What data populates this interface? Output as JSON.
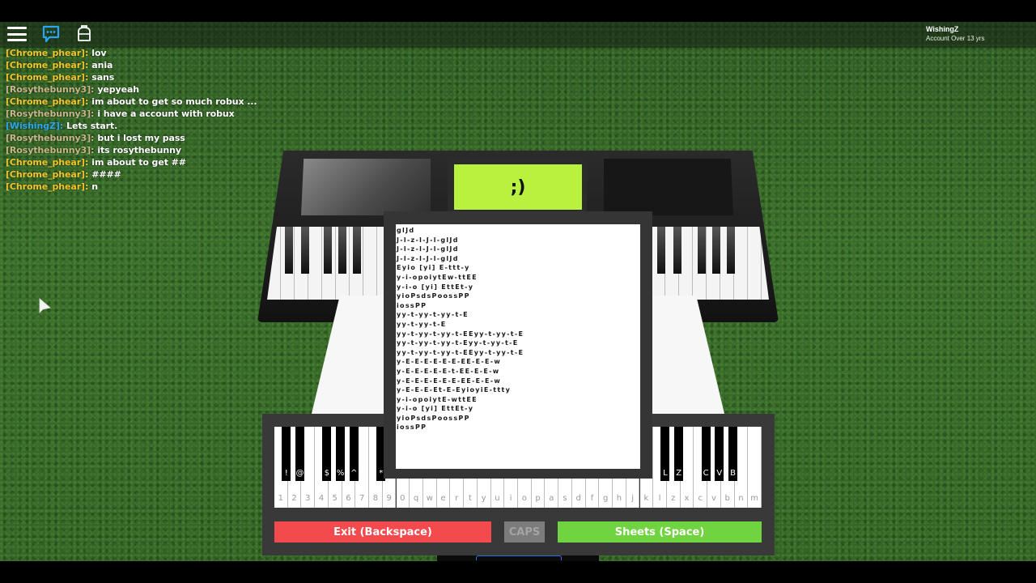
{
  "topbar": {
    "icons": [
      "menu-icon",
      "chat-icon",
      "backpack-icon"
    ],
    "account": {
      "username": "WishingZ",
      "status": "Account Over 13 yrs"
    }
  },
  "chat": {
    "messages": [
      {
        "speaker": "[Chrome_phear]:",
        "text": "lov",
        "color": "#f4c52a"
      },
      {
        "speaker": "[Chrome_phear]:",
        "text": "ania",
        "color": "#f4c52a"
      },
      {
        "speaker": "[Chrome_phear]:",
        "text": "sans",
        "color": "#f4c52a"
      },
      {
        "speaker": "[Rosythebunny3]:",
        "text": "yepyeah",
        "color": "#c9b58a"
      },
      {
        "speaker": "[Chrome_phear]:",
        "text": "im about to get so much robux ...",
        "color": "#f4c52a"
      },
      {
        "speaker": "[Rosythebunny3]:",
        "text": "i have a account with robux",
        "color": "#c9b58a"
      },
      {
        "speaker": "[WishingZ]:",
        "text": "Lets start.",
        "color": "#29a6f2"
      },
      {
        "speaker": "[Rosythebunny3]:",
        "text": "but i lost my pass",
        "color": "#c9b58a"
      },
      {
        "speaker": "[Rosythebunny3]:",
        "text": "its rosythebunny",
        "color": "#c9b58a"
      },
      {
        "speaker": "[Chrome_phear]:",
        "text": "im about to get ##",
        "color": "#f4c52a"
      },
      {
        "speaker": "[Chrome_phear]:",
        "text": "####",
        "color": "#f4c52a"
      },
      {
        "speaker": "[Chrome_phear]:",
        "text": "n",
        "color": "#f4c52a"
      }
    ]
  },
  "piano_display": {
    "screen_text": ";)",
    "screen_color": "#b8f23f"
  },
  "sheet": {
    "lines": [
      "glJd",
      "J-l-z-l-J-l-glJd",
      "J-l-z-l-J-l-glJd",
      "J-l-z-l-J-l-glJd",
      "Eyio [yi] E-ttt-y",
      "y-i-opoiytEw-ttEE",
      "y-i-o [yi] EttEt-y",
      "yioPsdsPoossPP",
      "iossPP",
      "yy-t-yy-t-yy-t-E",
      "yy-t-yy-t-E",
      "yy-t-yy-t-yy-t-EEyy-t-yy-t-E",
      "yy-t-yy-t-yy-t-Eyy-t-yy-t-E",
      "yy-t-yy-t-yy-t-EEyy-t-yy-t-E",
      "y-E-E-E-E-E-E-EE-E-E-w",
      "y-E-E-E-E-E-t-EE-E-E-w",
      "y-E-E-E-E-E-E-EE-E-E-w",
      "y-E-E-E-Et-E-EyioyiE-ttty",
      "y-i-opoiytE-wttEE",
      "y-i-o [yi] EttEt-y",
      "yioPsdsPoossPP",
      "iossPP"
    ]
  },
  "keyboard": {
    "white_keys": [
      "1",
      "2",
      "3",
      "4",
      "5",
      "6",
      "7",
      "8",
      "9",
      "0",
      "q",
      "w",
      "e",
      "r",
      "t",
      "y",
      "u",
      "i",
      "o",
      "p",
      "a",
      "s",
      "d",
      "f",
      "g",
      "h",
      "j",
      "k",
      "l",
      "z",
      "x",
      "c",
      "v",
      "b",
      "n",
      "m"
    ],
    "black_keys": [
      {
        "after": 0,
        "label": "!"
      },
      {
        "after": 1,
        "label": "@"
      },
      {
        "after": 3,
        "label": "$"
      },
      {
        "after": 4,
        "label": "%"
      },
      {
        "after": 5,
        "label": "^"
      },
      {
        "after": 7,
        "label": "*"
      },
      {
        "after": 28,
        "label": "L"
      },
      {
        "after": 29,
        "label": "Z"
      },
      {
        "after": 31,
        "label": "C"
      },
      {
        "after": 32,
        "label": "V"
      },
      {
        "after": 33,
        "label": "B"
      }
    ]
  },
  "buttons": {
    "exit": "Exit (Backspace)",
    "caps": "CAPS",
    "sheets": "Sheets (Space)"
  },
  "colors": {
    "exit": "#f24a4d",
    "caps": "#7c7c7c",
    "sheets": "#6fd43f"
  }
}
